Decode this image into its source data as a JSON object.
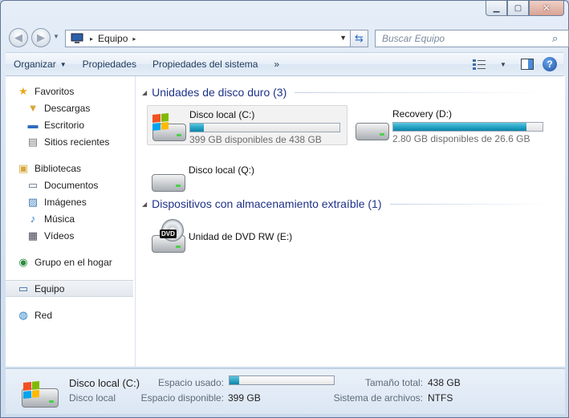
{
  "window": {
    "minimize_glyph": "▁",
    "maximize_glyph": "▢",
    "close_glyph": "✕"
  },
  "nav": {
    "back_glyph": "◀",
    "forward_glyph": "▶"
  },
  "address": {
    "separator": "▸",
    "location": "Equipo",
    "separator2": "▸"
  },
  "search": {
    "placeholder": "Buscar Equipo"
  },
  "toolbar": {
    "organize": "Organizar",
    "properties": "Propiedades",
    "system_properties": "Propiedades del sistema",
    "more": "»"
  },
  "sidebar": {
    "favorites": {
      "label": "Favoritos",
      "items": [
        "Descargas",
        "Escritorio",
        "Sitios recientes"
      ]
    },
    "libraries": {
      "label": "Bibliotecas",
      "items": [
        "Documentos",
        "Imágenes",
        "Música",
        "Vídeos"
      ]
    },
    "homegroup": "Grupo en el hogar",
    "computer": "Equipo",
    "network": "Red"
  },
  "groups": {
    "hard_disks": "Unidades de disco duro (3)",
    "removable": "Dispositivos con almacenamiento extraíble (1)"
  },
  "drives": [
    {
      "name": "Disco local (C:)",
      "free_text": "399 GB disponibles de 438 GB",
      "used_fraction": 0.09,
      "selected": true,
      "windows": true
    },
    {
      "name": "Recovery (D:)",
      "free_text": "2.80 GB disponibles de 26.6 GB",
      "used_fraction": 0.895,
      "selected": false,
      "windows": false
    },
    {
      "name": "Disco local (Q:)",
      "free_text": "",
      "used_fraction": null,
      "selected": false,
      "windows": false
    }
  ],
  "dvd": {
    "name": "Unidad de DVD RW (E:)",
    "badge": "DVD"
  },
  "details": {
    "name": "Disco local (C:)",
    "type": "Disco local",
    "used_label": "Espacio usado:",
    "used_fraction": 0.09,
    "free_label": "Espacio disponible:",
    "free_value": "399 GB",
    "total_label": "Tamaño total:",
    "total_value": "438 GB",
    "fs_label": "Sistema de archivos:",
    "fs_value": "NTFS"
  },
  "colors": {
    "accent": "#1e3287",
    "bar_fill": "#27a4c6"
  }
}
